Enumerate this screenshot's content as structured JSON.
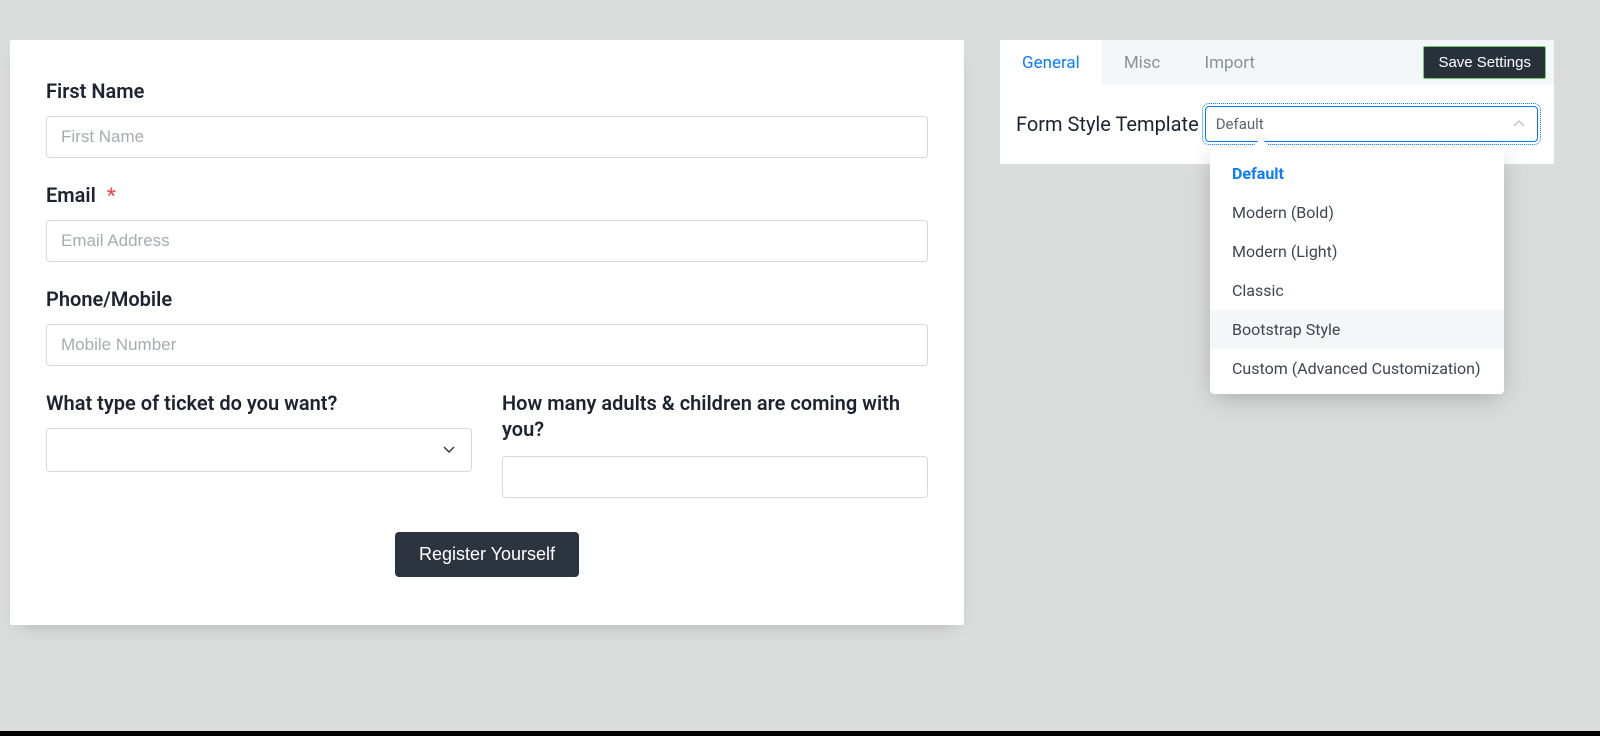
{
  "form": {
    "first_name": {
      "label": "First Name",
      "placeholder": "First Name"
    },
    "email": {
      "label": "Email",
      "required": true,
      "placeholder": "Email Address"
    },
    "phone": {
      "label": "Phone/Mobile",
      "placeholder": "Mobile Number"
    },
    "ticket_type": {
      "label": "What type of ticket do you want?"
    },
    "attendees": {
      "label": "How many adults & children are coming with you?"
    },
    "submit": {
      "label": "Register Yourself"
    }
  },
  "settings": {
    "tabs": {
      "general": "General",
      "misc": "Misc",
      "import": "Import"
    },
    "save_label": "Save Settings",
    "template_field": {
      "label": "Form Style Template",
      "selected": "Default",
      "options": [
        "Default",
        "Modern (Bold)",
        "Modern (Light)",
        "Classic",
        "Bootstrap Style",
        "Custom (Advanced Customization)"
      ],
      "active_index": 0,
      "hover_index": 4
    }
  }
}
